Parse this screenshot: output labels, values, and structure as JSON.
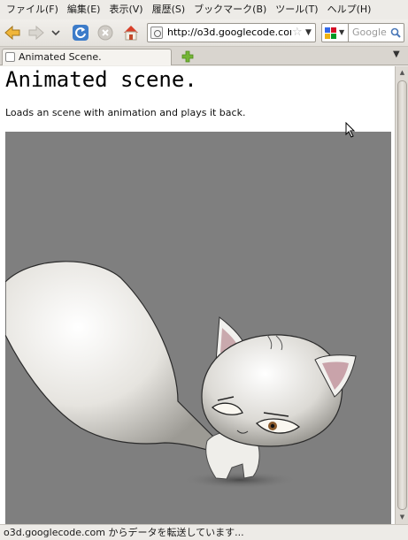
{
  "menubar": {
    "items": [
      "ファイル(F)",
      "編集(E)",
      "表示(V)",
      "履歴(S)",
      "ブックマーク(B)",
      "ツール(T)",
      "ヘルプ(H)"
    ]
  },
  "navbar": {
    "url": "http://o3d.googlecode.com",
    "search_placeholder": "Google"
  },
  "tabs": [
    {
      "title": "Animated Scene."
    }
  ],
  "page": {
    "heading": "Animated scene.",
    "description": "Loads an scene with animation and plays it back."
  },
  "status": {
    "text": "o3d.googlecode.com からデータを転送しています..."
  },
  "colors": {
    "viewport_bg": "#7f7f7f",
    "toolbar_bg": "#edebe7"
  }
}
